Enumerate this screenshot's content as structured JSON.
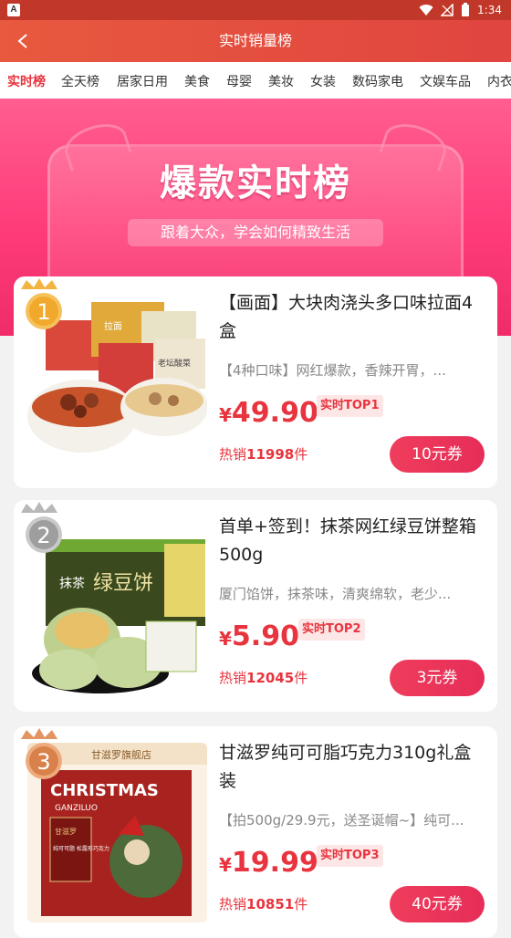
{
  "status_bar": {
    "left_badge": "A",
    "time": "1:34"
  },
  "header": {
    "title": "实时销量榜"
  },
  "tabs": [
    "实时榜",
    "全天榜",
    "居家日用",
    "美食",
    "母婴",
    "美妆",
    "女装",
    "数码家电",
    "文娱车品",
    "内衣"
  ],
  "banner": {
    "title": "爆款实时榜",
    "subtitle": "跟着大众，学会如何精致生活"
  },
  "products": [
    {
      "rank": "1",
      "name": "【画面】大块肉浇头多口味拉面4盒",
      "desc": "【4种口味】网红爆款，香辣开胃，...",
      "currency": "¥",
      "price": "49.90",
      "tag": "实时TOP1",
      "sales_prefix": "热销",
      "sales_count": "11998",
      "sales_suffix": "件",
      "coupon": "10元券"
    },
    {
      "rank": "2",
      "name": "首单+签到！抹茶网红绿豆饼整箱500g",
      "desc": "厦门馅饼，抹茶味，清爽绵软，老少...",
      "currency": "¥",
      "price": "5.90",
      "tag": "实时TOP2",
      "sales_prefix": "热销",
      "sales_count": "12045",
      "sales_suffix": "件",
      "coupon": "3元券"
    },
    {
      "rank": "3",
      "name": "甘滋罗纯可可脂巧克力310g礼盒装",
      "desc": "【拍500g/29.9元，送圣诞帽~】纯可...",
      "currency": "¥",
      "price": "19.99",
      "tag": "实时TOP3",
      "sales_prefix": "热销",
      "sales_count": "10851",
      "sales_suffix": "件",
      "coupon": "40元券"
    }
  ],
  "product_images": {
    "p1_box1": "拉面",
    "p1_box2": "老坛酸菜",
    "p2_brand": "抹茶",
    "p2_title": "绿豆饼",
    "p3_shop": "甘滋罗旗舰店",
    "p3_brand": "甘滋罗",
    "p3_title": "CHRISTMAS",
    "p3_sub": "GANZILUO",
    "p3_desc": "纯可可脂 松露形巧克力"
  },
  "colors": {
    "accent": "#e8343e",
    "header": "#e0453f",
    "banner": "#ff4a84"
  }
}
